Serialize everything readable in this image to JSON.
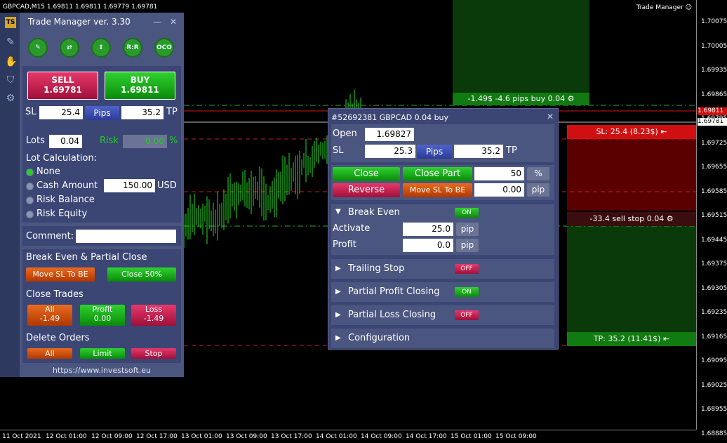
{
  "window": {
    "title": "GBPCAD,M15  1.69811 1.69811 1.69779 1.69781",
    "manager_label": "Trade Manager ☺"
  },
  "yaxis": [
    "1.70075",
    "1.70005",
    "1.69935",
    "1.69865",
    "1.69795",
    "1.69725",
    "1.69655",
    "1.69585",
    "1.69515",
    "1.69445",
    "1.69375",
    "1.69305",
    "1.69235",
    "1.69165",
    "1.69095",
    "1.69025",
    "1.68955",
    "1.68885"
  ],
  "price_tags": {
    "bid": "1.69811",
    "ask": "1.69781"
  },
  "xaxis": [
    "11 Oct 2021",
    "12 Oct 01:00",
    "12 Oct 09:00",
    "12 Oct 17:00",
    "13 Oct 01:00",
    "13 Oct 09:00",
    "13 Oct 17:00",
    "14 Oct 01:00",
    "14 Oct 09:00",
    "14 Oct 17:00",
    "15 Oct 01:00",
    "15 Oct 09:00"
  ],
  "chart_labels": {
    "profit": "-1.49$ -4.6 pips buy 0.04",
    "sl": "SL: 25.4 (8.23$)",
    "sellstop": "-33.4 sell stop 0.04",
    "tp": "TP: 35.2 (11.41$)"
  },
  "panel": {
    "title": "Trade Manager ver. 3.30",
    "min": "—",
    "close": "✕",
    "top_icons": [
      "✎",
      "⇄",
      "⇕",
      "R:R",
      "OCO"
    ],
    "sell_label": "SELL",
    "sell_price": "1.69781",
    "buy_label": "BUY",
    "buy_price": "1.69811",
    "sl_label": "SL",
    "sl_value": "25.4",
    "pips_label": "Pips",
    "tp_value": "35.2",
    "tp_label": "TP",
    "lots_label": "Lots",
    "lots_value": "0.04",
    "risk_label": "Risk",
    "risk_value": "0.00",
    "percent": "%",
    "lotcalc_label": "Lot Calculation:",
    "options": [
      "None",
      "Cash Amount",
      "Risk Balance",
      "Risk Equity"
    ],
    "cash_value": "150.00",
    "currency": "USD",
    "comment_label": "Comment:",
    "be_title": "Break Even & Partial Close",
    "move_sl": "Move SL To BE",
    "close50": "Close 50%",
    "close_trades": "Close Trades",
    "ct_all": "All",
    "ct_all_v": "-1.49",
    "ct_profit": "Profit",
    "ct_profit_v": "0.00",
    "ct_loss": "Loss",
    "ct_loss_v": "-1.49",
    "delete_orders": "Delete Orders",
    "do_all": "All",
    "do_limit": "Limit",
    "do_stop": "Stop",
    "url": "https://www.investsoft.eu"
  },
  "dialog": {
    "title": "#52692381 GBPCAD 0.04 buy",
    "close": "✕",
    "open_label": "Open",
    "open_value": "1.69827",
    "sl_label": "SL",
    "sl_value": "25.3",
    "pips": "Pips",
    "tp_value": "35.2",
    "tp_label": "TP",
    "close_btn": "Close",
    "close_part": "Close Part",
    "part_value": "50",
    "pct": "%",
    "reverse": "Reverse",
    "move_sl": "Move SL To BE",
    "be_value": "0.00",
    "pip": "pip",
    "break_even": "Break Even",
    "be_toggle": "ON",
    "activate_label": "Activate",
    "activate_value": "25.0",
    "profit_label": "Profit",
    "profit_value": "0.0",
    "sections": [
      {
        "label": "Trailing Stop",
        "state": "OFF"
      },
      {
        "label": "Partial Profit Closing",
        "state": "ON"
      },
      {
        "label": "Partial Loss Closing",
        "state": "OFF"
      },
      {
        "label": "Configuration",
        "state": ""
      }
    ]
  }
}
